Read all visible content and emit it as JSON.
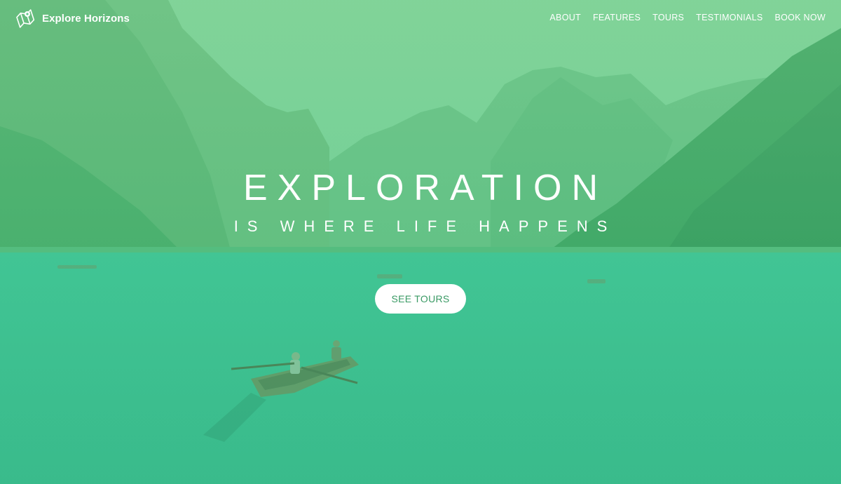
{
  "brand": {
    "name": "Explore Horizons",
    "icon": "map-icon"
  },
  "nav": {
    "items": [
      "ABOUT",
      "FEATURES",
      "TOURS",
      "TESTIMONIALS",
      "BOOK NOW"
    ]
  },
  "hero": {
    "title": "EXPLORATION",
    "subtitle": "IS WHERE LIFE HAPPENS",
    "cta_label": "SEE TOURS"
  },
  "colors": {
    "overlay": "#3fbf86",
    "cta_text": "#3a9a64",
    "text": "#ffffff"
  }
}
